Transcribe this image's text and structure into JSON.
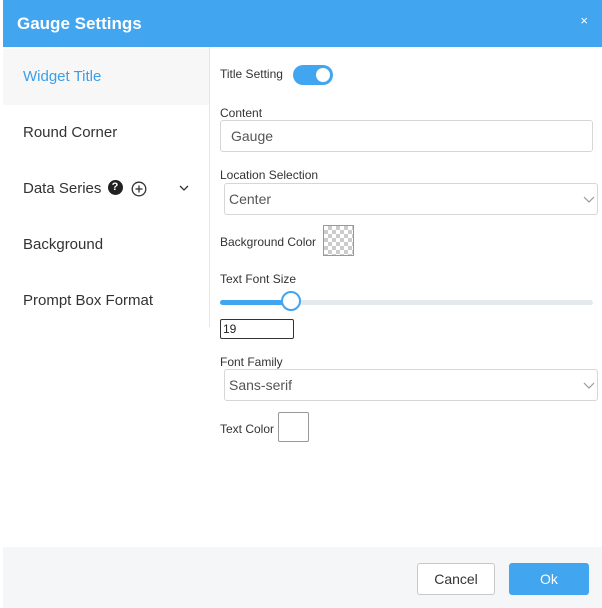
{
  "header": {
    "title": "Gauge Settings",
    "close_glyph": "×"
  },
  "sidebar": {
    "items": [
      {
        "label": "Widget Title",
        "active": true
      },
      {
        "label": "Round Corner",
        "active": false
      },
      {
        "label": "Data Series",
        "active": false,
        "help_glyph": "?",
        "icons": [
          "help-icon",
          "add-circle-icon",
          "chevron-down-icon"
        ]
      },
      {
        "label": "Background",
        "active": false
      },
      {
        "label": "Prompt Box Format",
        "active": false
      }
    ]
  },
  "form": {
    "title_setting": {
      "label": "Title Setting",
      "enabled": true
    },
    "content": {
      "label": "Content",
      "value": "Gauge"
    },
    "location": {
      "label": "Location Selection",
      "value": "Center"
    },
    "background_color": {
      "label": "Background Color",
      "value": "transparent"
    },
    "text_font_size": {
      "label": "Text Font Size",
      "value": "19",
      "slider_fraction": 0.19
    },
    "font_family": {
      "label": "Font Family",
      "value": "Sans-serif"
    },
    "text_color": {
      "label": "Text Color",
      "value": "#ffffff"
    }
  },
  "footer": {
    "cancel_label": "Cancel",
    "ok_label": "Ok"
  },
  "colors": {
    "accent": "#42a5f0",
    "active_text": "#3a9ee8",
    "footer_bg": "#f5f6f8"
  }
}
